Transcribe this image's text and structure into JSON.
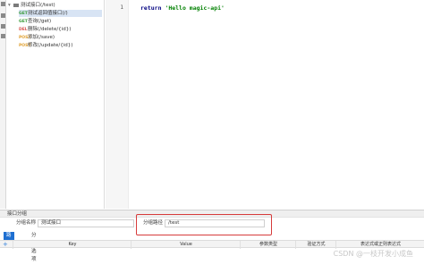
{
  "tree": {
    "root_label": "测试接口(/test)",
    "items": [
      {
        "method": "GET",
        "label": "测试返回值接口(/)",
        "method_color": "#3a9b3a"
      },
      {
        "method": "GET",
        "label": "查询(/get)",
        "method_color": "#3a9b3a"
      },
      {
        "method": "DEL",
        "label": "删除(/delete/{id})",
        "method_color": "#d9534f"
      },
      {
        "method": "POST",
        "label": "添加(/save)",
        "method_color": "#e0a030"
      },
      {
        "method": "POST",
        "label": "修改(/update/{id})",
        "method_color": "#e0a030"
      }
    ]
  },
  "editor": {
    "line_numbers": [
      "1"
    ],
    "keyword": "return",
    "string": "'Hello magic-api'"
  },
  "panel": {
    "title": "接口分组",
    "group_name_label": "分组名称",
    "group_name_value": "测试接口",
    "group_path_label": "分组路径",
    "group_path_value": "/test",
    "tabs": [
      "路径变量",
      "分组选项"
    ],
    "columns": [
      "Key",
      "Value",
      "参数类型",
      "验证方式",
      "表达式或正则表达式"
    ]
  },
  "watermark": "CSDN @一枝开发小成鱼",
  "colors": {
    "accent": "#1e6fd1",
    "highlight_border": "#d63b3b",
    "selected_row": "#d8e4f4"
  }
}
